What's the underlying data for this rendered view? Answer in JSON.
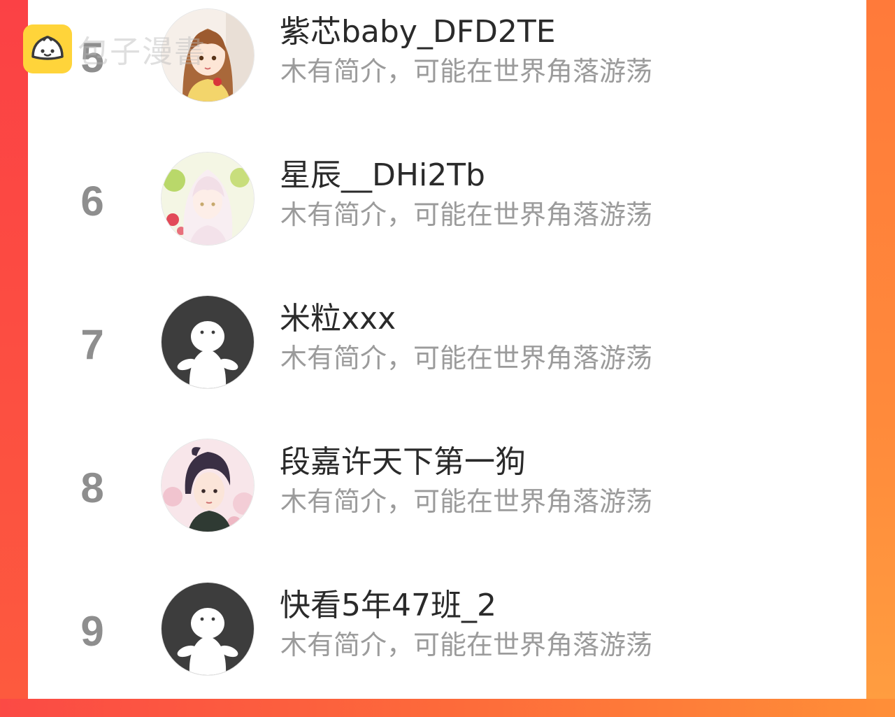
{
  "watermark": {
    "text": "包子漫書",
    "icon": "bun-logo-icon",
    "color": "#ffd43a"
  },
  "colors": {
    "bg_left": "#fb4145",
    "bg_right": "#ff8a3b",
    "panel": "#ffffff",
    "rank": "#8e8e8e",
    "name": "#2a2a2a",
    "bio": "#9b9b9b"
  },
  "rows": [
    {
      "rank": "5",
      "name": "紫芯baby_DFD2TE",
      "bio": "木有简介，可能在世界角落游荡",
      "avatar": "illustrated-girl-brown-hair-avatar"
    },
    {
      "rank": "6",
      "name": "星辰__DHi2Tb",
      "bio": "木有简介，可能在世界角落游荡",
      "avatar": "illustrated-girl-white-hair-flowers-avatar"
    },
    {
      "rank": "7",
      "name": "米粒xxx",
      "bio": "木有简介，可能在世界角落游荡",
      "avatar": "default-ghost-avatar"
    },
    {
      "rank": "8",
      "name": "段嘉许天下第一狗",
      "bio": "木有简介，可能在世界角落游荡",
      "avatar": "illustrated-boy-dark-hair-avatar"
    },
    {
      "rank": "9",
      "name": "快看5年47班_2",
      "bio": "木有简介，可能在世界角落游荡",
      "avatar": "default-ghost-avatar"
    }
  ]
}
